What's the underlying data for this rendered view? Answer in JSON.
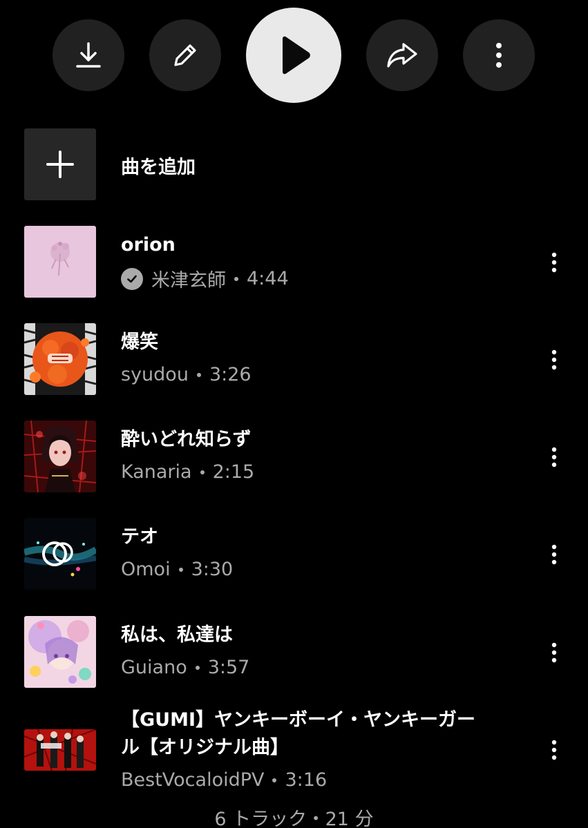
{
  "actions": {
    "download_icon": "download-icon",
    "edit_icon": "pencil-icon",
    "play_icon": "play-icon",
    "share_icon": "share-icon",
    "more_icon": "more-vertical-icon"
  },
  "add_song": {
    "label": "曲を追加",
    "icon": "plus-icon"
  },
  "tracks": [
    {
      "title": "orion",
      "artist": "米津玄師",
      "duration": "4:44",
      "verified": true
    },
    {
      "title": "爆笑",
      "artist": "syudou",
      "duration": "3:26",
      "verified": false
    },
    {
      "title": "酔いどれ知らず",
      "artist": "Kanaria",
      "duration": "2:15",
      "verified": false
    },
    {
      "title": "テオ",
      "artist": "Omoi",
      "duration": "3:30",
      "verified": false
    },
    {
      "title": "私は、私達は",
      "artist": "Guiano",
      "duration": "3:57",
      "verified": false
    },
    {
      "title_line1": "【GUMI】ヤンキーボーイ・ヤンキーガー",
      "title_line2": "ル【オリジナル曲】",
      "artist": "BestVocaloidPV",
      "duration": "3:16",
      "verified": false
    }
  ],
  "footer": {
    "summary": "6 トラック・21 分"
  },
  "colors": {
    "background": "#000000",
    "button_bg": "#212121",
    "play_bg": "#e9e9e9",
    "secondary_text": "#aaaaaa"
  }
}
